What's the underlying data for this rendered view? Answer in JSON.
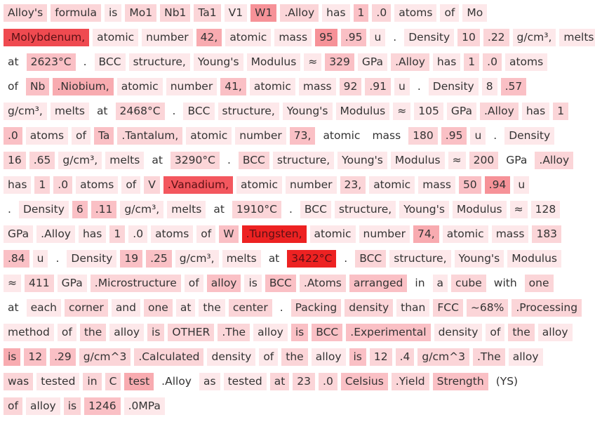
{
  "lines": [
    [
      [
        "Alloy's",
        2
      ],
      [
        "formula",
        2
      ],
      [
        "is",
        1
      ],
      [
        "Mo1",
        2
      ],
      [
        "Nb1",
        2
      ],
      [
        "Ta1",
        2
      ],
      [
        "V1",
        1
      ],
      [
        "W1",
        5
      ],
      [
        ".Alloy",
        2
      ],
      [
        "has",
        1
      ],
      [
        "1",
        3
      ],
      [
        ".0",
        2
      ],
      [
        "atoms",
        1
      ],
      [
        "of",
        1
      ],
      [
        "Mo",
        1
      ]
    ],
    [
      [
        ".Molybdenum,",
        7
      ],
      [
        "atomic",
        1
      ],
      [
        "number",
        1
      ],
      [
        "42,",
        4
      ],
      [
        "atomic",
        1
      ],
      [
        "mass",
        1
      ],
      [
        "95",
        5
      ],
      [
        ".95",
        3
      ],
      [
        "u",
        1
      ],
      [
        ".",
        0
      ],
      [
        "Density",
        1
      ],
      [
        "10",
        2
      ],
      [
        ".22",
        2
      ],
      [
        "g/cm³,",
        1
      ],
      [
        "melts",
        1
      ]
    ],
    [
      [
        "at",
        0
      ],
      [
        "2623°C",
        3
      ],
      [
        ".",
        0
      ],
      [
        "BCC",
        1
      ],
      [
        "structure,",
        1
      ],
      [
        "Young's",
        1
      ],
      [
        "Modulus",
        1
      ],
      [
        "≈",
        1
      ],
      [
        "329",
        3
      ],
      [
        "GPa",
        1
      ],
      [
        ".Alloy",
        2
      ],
      [
        "has",
        1
      ],
      [
        "1",
        2
      ],
      [
        ".0",
        2
      ],
      [
        "atoms",
        1
      ]
    ],
    [
      [
        "of",
        0
      ],
      [
        "Nb",
        3
      ],
      [
        ".Niobium,",
        4
      ],
      [
        "atomic",
        1
      ],
      [
        "number",
        1
      ],
      [
        "41,",
        3
      ],
      [
        "atomic",
        1
      ],
      [
        "mass",
        1
      ],
      [
        "92",
        2
      ],
      [
        ".91",
        2
      ],
      [
        "u",
        1
      ],
      [
        ".",
        0
      ],
      [
        "Density",
        1
      ],
      [
        "8",
        1
      ],
      [
        ".57",
        3
      ]
    ],
    [
      [
        "g/cm³,",
        1
      ],
      [
        "melts",
        1
      ],
      [
        "at",
        0
      ],
      [
        "2468°C",
        2
      ],
      [
        ".",
        0
      ],
      [
        "BCC",
        1
      ],
      [
        "structure,",
        1
      ],
      [
        "Young's",
        1
      ],
      [
        "Modulus",
        1
      ],
      [
        "≈",
        1
      ],
      [
        "105",
        1
      ],
      [
        "GPa",
        1
      ],
      [
        ".Alloy",
        2
      ],
      [
        "has",
        1
      ],
      [
        "1",
        2
      ]
    ],
    [
      [
        ".0",
        3
      ],
      [
        "atoms",
        1
      ],
      [
        "of",
        1
      ],
      [
        "Ta",
        3
      ],
      [
        ".Tantalum,",
        2
      ],
      [
        "atomic",
        1
      ],
      [
        "number",
        1
      ],
      [
        "73,",
        3
      ],
      [
        "atomic",
        0
      ],
      [
        "mass",
        0
      ],
      [
        "180",
        2
      ],
      [
        ".95",
        3
      ],
      [
        "u",
        1
      ],
      [
        ".",
        0
      ],
      [
        "Density",
        1
      ]
    ],
    [
      [
        "16",
        2
      ],
      [
        ".65",
        2
      ],
      [
        "g/cm³,",
        1
      ],
      [
        "melts",
        1
      ],
      [
        "at",
        0
      ],
      [
        "3290°C",
        2
      ],
      [
        ".",
        0
      ],
      [
        "BCC",
        2
      ],
      [
        "structure,",
        1
      ],
      [
        "Young's",
        1
      ],
      [
        "Modulus",
        1
      ],
      [
        "≈",
        1
      ],
      [
        "200",
        2
      ],
      [
        "GPa",
        0
      ],
      [
        ".Alloy",
        2
      ]
    ],
    [
      [
        "has",
        1
      ],
      [
        "1",
        2
      ],
      [
        ".0",
        2
      ],
      [
        "atoms",
        1
      ],
      [
        "of",
        1
      ],
      [
        "V",
        2
      ],
      [
        ".Vanadium,",
        6
      ],
      [
        "atomic",
        1
      ],
      [
        "number",
        1
      ],
      [
        "23,",
        2
      ],
      [
        "atomic",
        1
      ],
      [
        "mass",
        1
      ],
      [
        "50",
        3
      ],
      [
        ".94",
        5
      ],
      [
        "u",
        1
      ]
    ],
    [
      [
        ".",
        0
      ],
      [
        "Density",
        1
      ],
      [
        "6",
        3
      ],
      [
        ".11",
        3
      ],
      [
        "g/cm³,",
        1
      ],
      [
        "melts",
        1
      ],
      [
        "at",
        0
      ],
      [
        "1910°C",
        2
      ],
      [
        ".",
        0
      ],
      [
        "BCC",
        1
      ],
      [
        "structure,",
        1
      ],
      [
        "Young's",
        1
      ],
      [
        "Modulus",
        1
      ],
      [
        "≈",
        1
      ],
      [
        "128",
        1
      ]
    ],
    [
      [
        "GPa",
        1
      ],
      [
        ".Alloy",
        1
      ],
      [
        "has",
        1
      ],
      [
        "1",
        2
      ],
      [
        ".0",
        1
      ],
      [
        "atoms",
        1
      ],
      [
        "of",
        1
      ],
      [
        "W",
        3
      ],
      [
        ".Tungsten,",
        8
      ],
      [
        "atomic",
        1
      ],
      [
        "number",
        1
      ],
      [
        "74,",
        4
      ],
      [
        "atomic",
        1
      ],
      [
        "mass",
        1
      ],
      [
        "183",
        2
      ]
    ],
    [
      [
        ".84",
        3
      ],
      [
        "u",
        1
      ],
      [
        ".",
        0
      ],
      [
        "Density",
        1
      ],
      [
        "19",
        3
      ],
      [
        ".25",
        3
      ],
      [
        "g/cm³,",
        1
      ],
      [
        "melts",
        1
      ],
      [
        "at",
        0
      ],
      [
        "3422°C",
        8
      ],
      [
        ".",
        0
      ],
      [
        "BCC",
        2
      ],
      [
        "structure,",
        1
      ],
      [
        "Young's",
        1
      ],
      [
        "Modulus",
        1
      ]
    ],
    [
      [
        "≈",
        1
      ],
      [
        "411",
        2
      ],
      [
        "GPa",
        1
      ],
      [
        ".Microstructure",
        2
      ],
      [
        "of",
        1
      ],
      [
        "alloy",
        3
      ],
      [
        "is",
        1
      ],
      [
        "BCC",
        3
      ],
      [
        ".Atoms",
        2
      ],
      [
        "arranged",
        3
      ],
      [
        "in",
        0
      ],
      [
        "a",
        1
      ],
      [
        "cube",
        2
      ],
      [
        "with",
        0
      ],
      [
        "one",
        2
      ]
    ],
    [
      [
        "at",
        0
      ],
      [
        "each",
        1
      ],
      [
        "corner",
        2
      ],
      [
        "and",
        1
      ],
      [
        "one",
        2
      ],
      [
        "at",
        1
      ],
      [
        "the",
        1
      ],
      [
        "center",
        2
      ],
      [
        ".",
        0
      ],
      [
        "Packing",
        2
      ],
      [
        "density",
        2
      ],
      [
        "than",
        1
      ],
      [
        "FCC",
        2
      ],
      [
        "~68%",
        2
      ],
      [
        ".Processing",
        2
      ]
    ],
    [
      [
        "method",
        1
      ],
      [
        "of",
        1
      ],
      [
        "the",
        2
      ],
      [
        "alloy",
        1
      ],
      [
        "is",
        2
      ],
      [
        "OTHER",
        2
      ],
      [
        ".The",
        2
      ],
      [
        "alloy",
        1
      ],
      [
        "is",
        3
      ],
      [
        "BCC",
        3
      ],
      [
        ".Experimental",
        3
      ],
      [
        "density",
        1
      ],
      [
        "of",
        1
      ],
      [
        "the",
        2
      ],
      [
        "alloy",
        1
      ]
    ],
    [
      [
        "is",
        4
      ],
      [
        "12",
        3
      ],
      [
        ".29",
        3
      ],
      [
        "g/cm^3",
        2
      ],
      [
        ".Calculated",
        2
      ],
      [
        "density",
        1
      ],
      [
        "of",
        1
      ],
      [
        "the",
        2
      ],
      [
        "alloy",
        1
      ],
      [
        "is",
        3
      ],
      [
        "12",
        2
      ],
      [
        ".4",
        2
      ],
      [
        "g/cm^3",
        2
      ],
      [
        ".The",
        2
      ],
      [
        "alloy",
        1
      ]
    ],
    [
      [
        "was",
        2
      ],
      [
        "tested",
        1
      ],
      [
        "in",
        2
      ],
      [
        "C",
        2
      ],
      [
        "test",
        4
      ],
      [
        ".Alloy",
        0
      ],
      [
        "as",
        1
      ],
      [
        "tested",
        1
      ],
      [
        "at",
        2
      ],
      [
        "23",
        2
      ],
      [
        ".0",
        2
      ],
      [
        "Celsius",
        3
      ],
      [
        ".Yield",
        2
      ],
      [
        "Strength",
        3
      ],
      [
        "(YS)",
        0
      ]
    ],
    [
      [
        "of",
        2
      ],
      [
        "alloy",
        1
      ],
      [
        "is",
        2
      ],
      [
        "1246",
        3
      ],
      [
        ".0MPa",
        1
      ]
    ]
  ],
  "palette": [
    "#ffffff",
    "#fde8ea",
    "#fbd5d8",
    "#fac0c5",
    "#f8abb0",
    "#f69298",
    "#f3575e",
    "#ef4a50",
    "#ed2222"
  ]
}
